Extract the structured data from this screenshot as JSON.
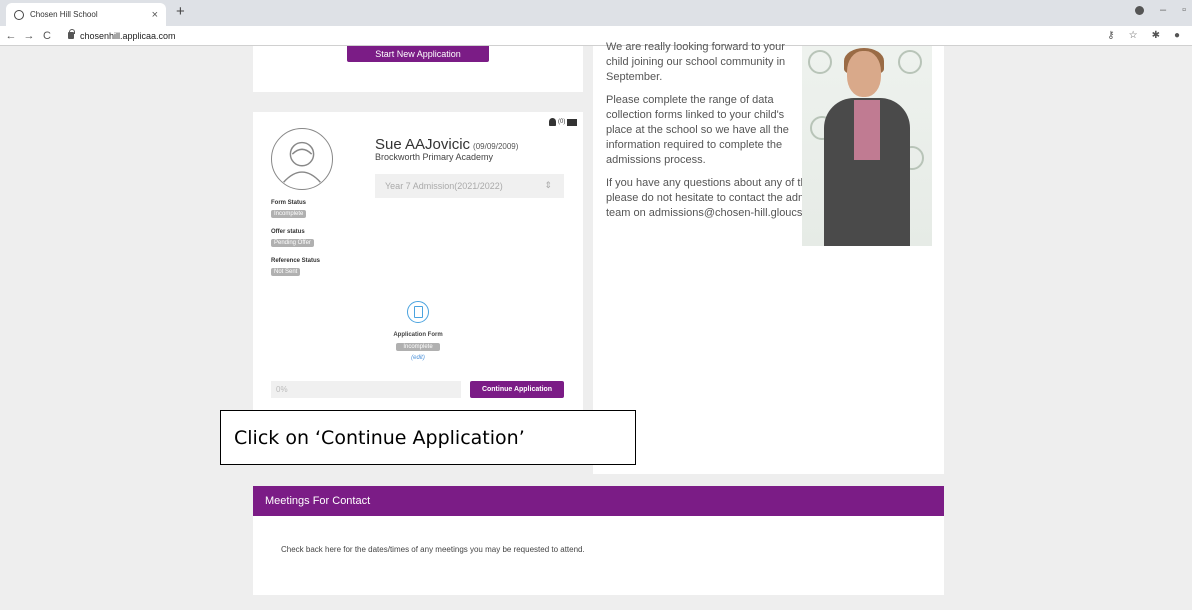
{
  "browser": {
    "tab_title": "Chosen Hill School",
    "tab_close": "×",
    "new_tab": "+",
    "url": "chosenhill.applicaa.com",
    "nav_back": "←",
    "nav_forward": "→",
    "nav_reload": "C"
  },
  "top_card": {
    "start_button": "Start New Application"
  },
  "application": {
    "student_name": "Sue AAJovicic",
    "dob": "(09/09/2009)",
    "school": "Brockworth Primary Academy",
    "notification_count": "(0)",
    "year_select": "Year 7 Admission(2021/2022)",
    "select_arrow": "⇕",
    "form_status_label": "Form Status",
    "form_status_value": "Incomplete",
    "offer_status_label": "Offer status",
    "offer_status_value": "Pending Offer",
    "reference_status_label": "Reference Status",
    "reference_status_value": "Not Sent",
    "form_label": "Application Form",
    "form_badge": "Incomplete",
    "edit_label": "(edit)",
    "progress_text": "0%",
    "progress_fraction": 0,
    "continue_button": "Continue Application"
  },
  "welcome": {
    "p1": "We are really looking forward to your child joining our school community in September.",
    "p2": "Please complete the range of data collection forms linked to your child's place at the school so we have all the information required to complete the admissions process.",
    "p3": "If you have any questions about any of the forms, please do not hesitate to contact the admissions team on admissions@chosen-hill.gloucs.sch.uk."
  },
  "meetings": {
    "title": "Meetings For Contact",
    "text": "Check back here for the dates/times of any meetings you may be requested to attend."
  },
  "callout": {
    "text": "Click on ‘Continue Application’"
  },
  "colors": {
    "brand_purple": "#7b1c86",
    "badge_grey": "#b0b0b0",
    "icon_blue": "#4aa3df"
  }
}
